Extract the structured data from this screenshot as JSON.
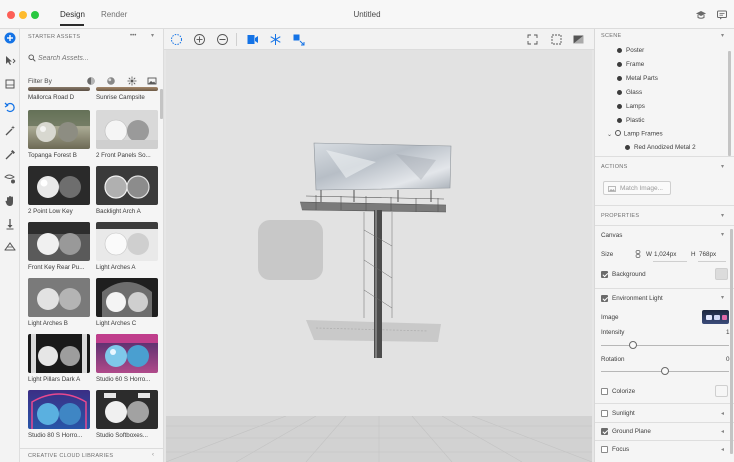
{
  "titlebar": {
    "tabs": [
      {
        "label": "Design",
        "active": true
      },
      {
        "label": "Render",
        "active": false
      }
    ],
    "document_title": "Untitled"
  },
  "assets": {
    "header": "STARTER ASSETS",
    "more": "•••",
    "search_placeholder": "Search Assets...",
    "filter_label": "Filter By",
    "items": [
      {
        "label": "Mallorca Road D",
        "type": "env-road"
      },
      {
        "label": "Sunrise Campsite",
        "type": "env-camp"
      },
      {
        "label": "Topanga Forest B",
        "type": "env-forest"
      },
      {
        "label": "2 Front Panels So...",
        "type": "spheres-light"
      },
      {
        "label": "2 Point Low Key",
        "type": "spheres-dark"
      },
      {
        "label": "Backlight Arch A",
        "type": "spheres-grey"
      },
      {
        "label": "Front Key Rear Pu...",
        "type": "spheres-mid"
      },
      {
        "label": "Light Arches A",
        "type": "spheres-bright"
      },
      {
        "label": "Light Arches B",
        "type": "spheres-mid2"
      },
      {
        "label": "Light Arches C",
        "type": "spheres-arch"
      },
      {
        "label": "Light Pillars Dark A",
        "type": "spheres-pillars"
      },
      {
        "label": "Studio 60 S Horro...",
        "type": "studio-purple"
      },
      {
        "label": "Studio 80 S Horro...",
        "type": "studio-blue"
      },
      {
        "label": "Studio Softboxes...",
        "type": "spheres-softbox"
      }
    ],
    "footer": "CREATIVE CLOUD LIBRARIES"
  },
  "scene": {
    "header": "SCENE",
    "items": [
      {
        "label": "Poster"
      },
      {
        "label": "Frame"
      },
      {
        "label": "Metal Parts"
      },
      {
        "label": "Glass"
      },
      {
        "label": "Lamps"
      },
      {
        "label": "Plastic"
      },
      {
        "label": "Lamp Frames"
      },
      {
        "label": "Red Anodized Metal 2"
      }
    ]
  },
  "actions": {
    "header": "ACTIONS",
    "match_image": "Match Image..."
  },
  "properties": {
    "header": "PROPERTIES",
    "canvas_label": "Canvas",
    "size_label": "Size",
    "w_label": "W",
    "width_value": "1,024px",
    "h_label": "H",
    "height_value": "768px",
    "background_label": "Background",
    "environment_light_label": "Environment Light",
    "image_label": "Image",
    "intensity_label": "Intensity",
    "intensity_value": "1",
    "rotation_label": "Rotation",
    "rotation_value": "0",
    "colorize_label": "Colorize",
    "sunlight_label": "Sunlight",
    "ground_plane_label": "Ground Plane",
    "focus_label": "Focus",
    "background_checked": true,
    "environment_light_checked": true,
    "colorize_checked": false,
    "sunlight_checked": false,
    "ground_plane_checked": true,
    "focus_checked": false,
    "intensity_fraction": 0.25,
    "rotation_fraction": 0.5
  },
  "colors": {
    "accent": "#1473e6",
    "panel": "#f5f5f5",
    "viewport": "#e2e2e2"
  }
}
